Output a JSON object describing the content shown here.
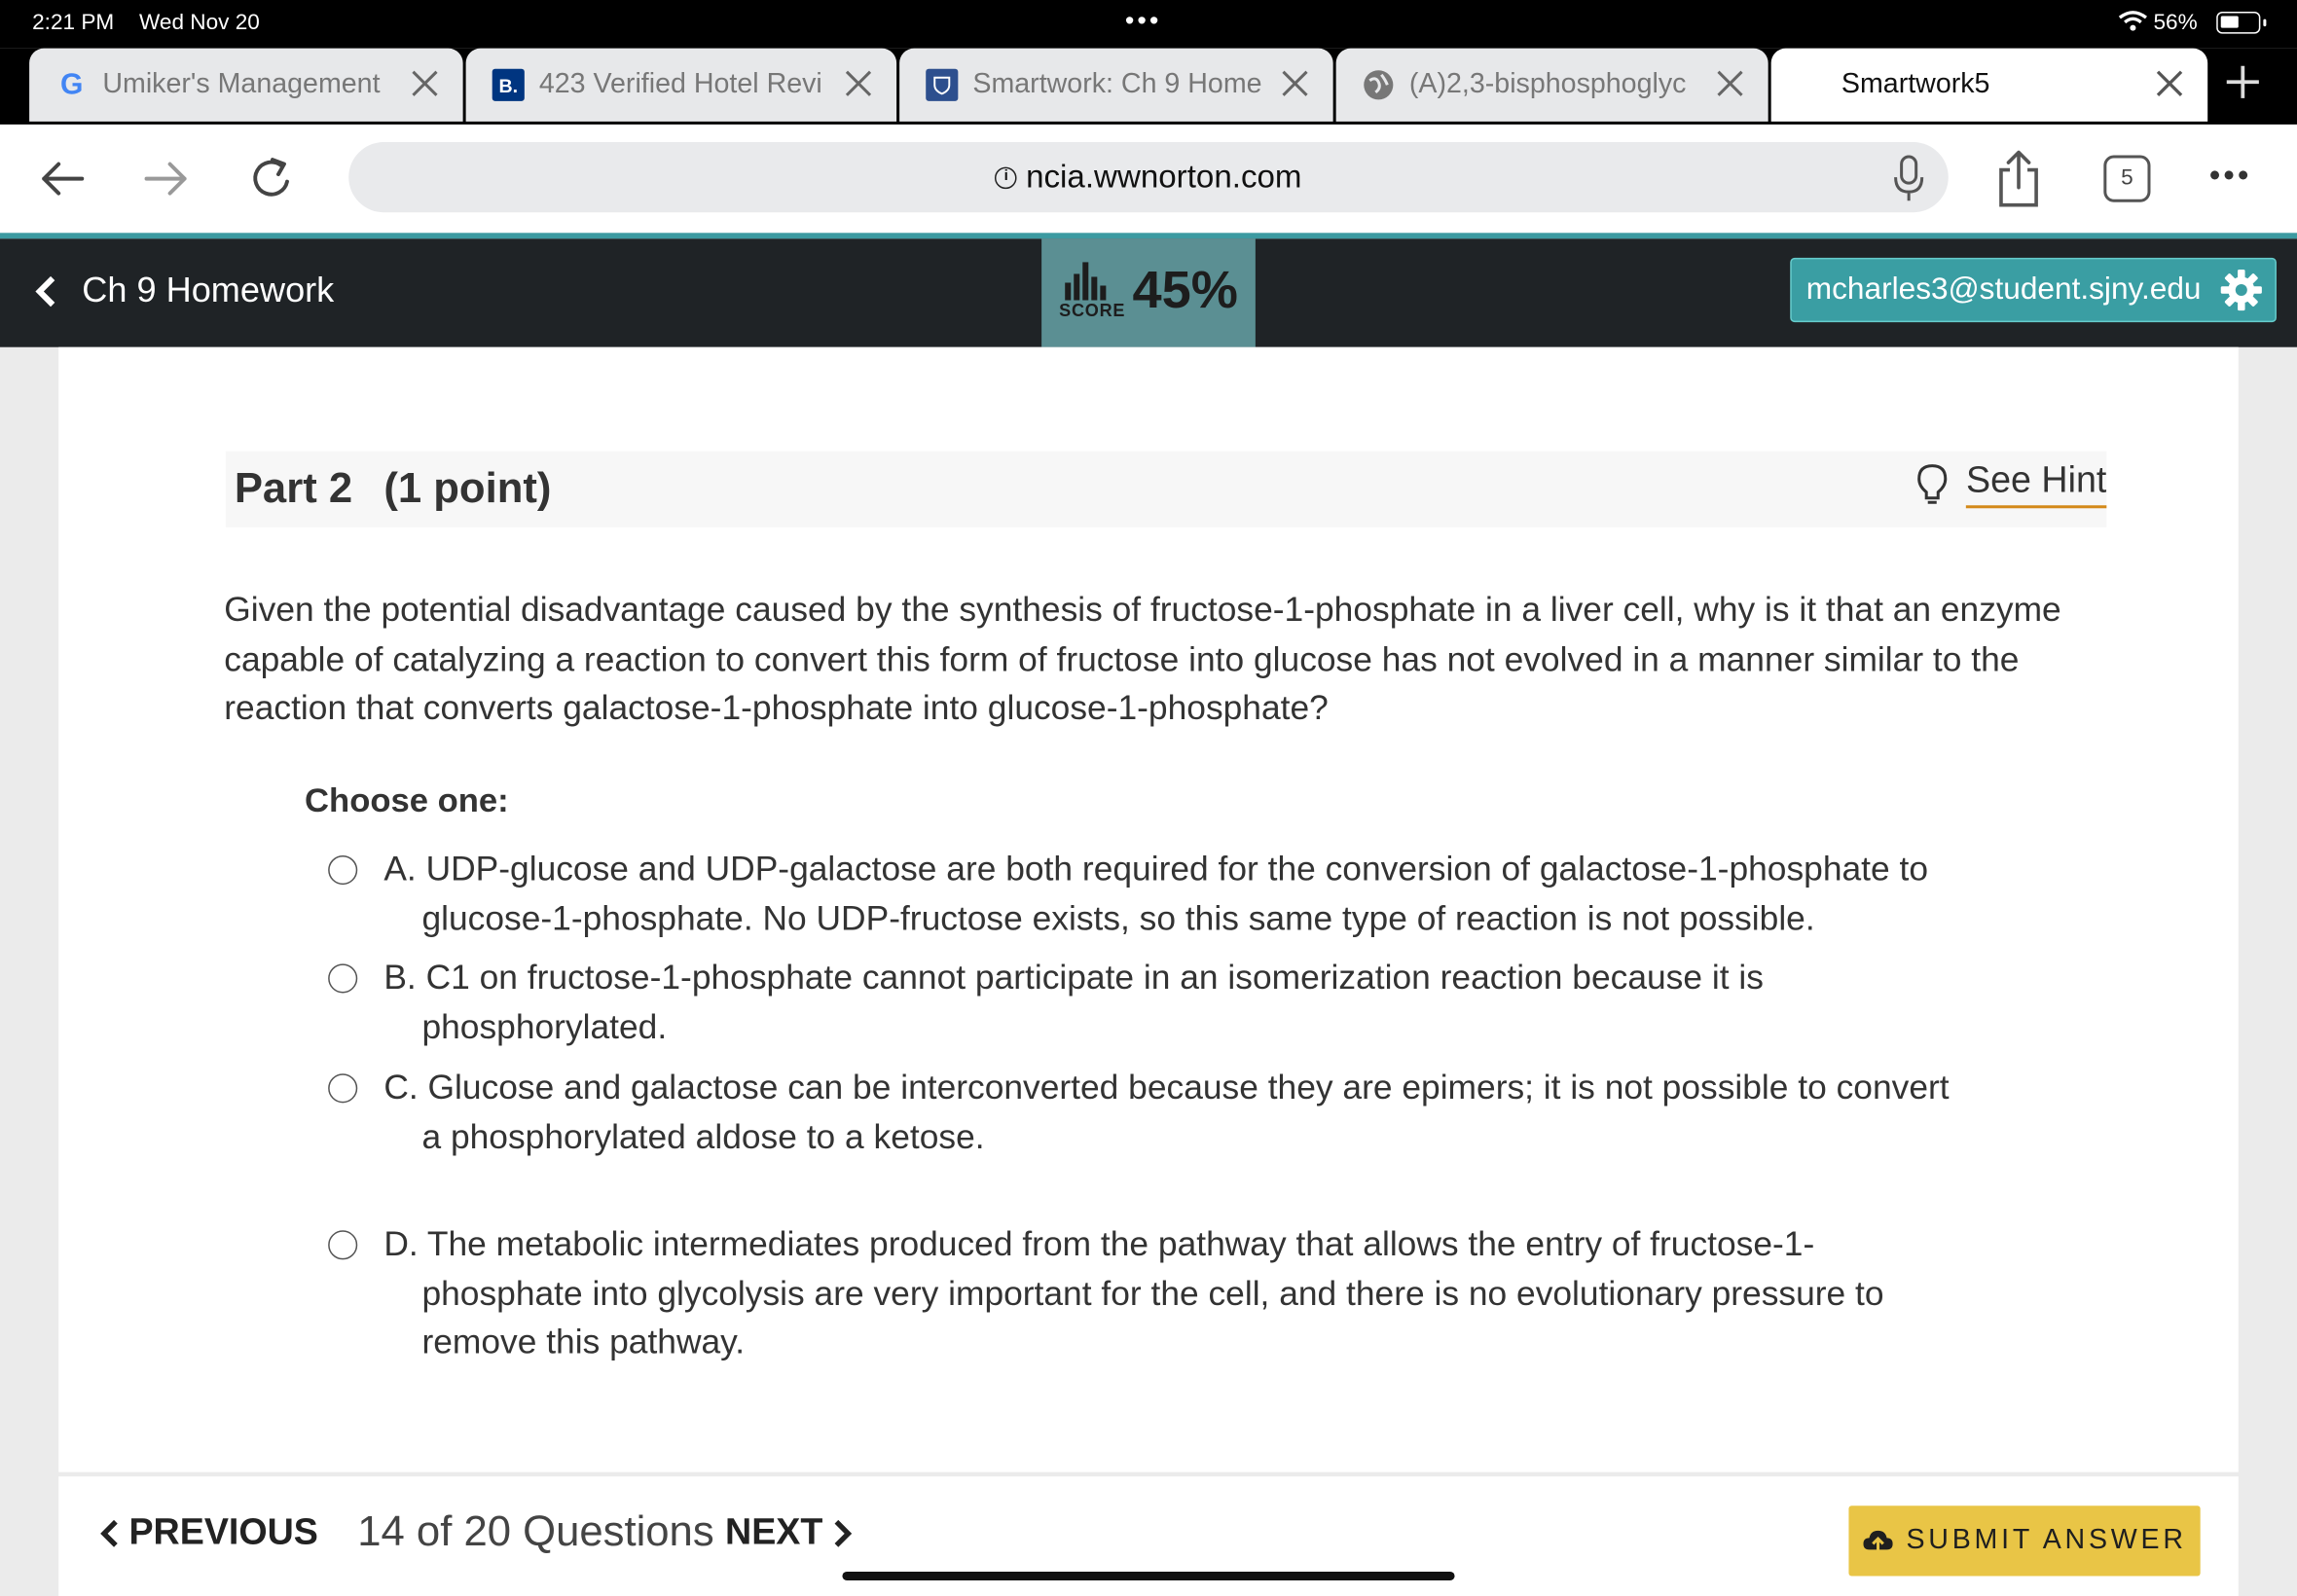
{
  "status_bar": {
    "time": "2:21 PM",
    "date": "Wed Nov 20",
    "battery": "56%"
  },
  "browser": {
    "tabs": [
      {
        "title": "Umiker's Management",
        "favicon": "G"
      },
      {
        "title": "423 Verified Hotel Revi",
        "favicon": "B."
      },
      {
        "title": "Smartwork: Ch 9 Home",
        "favicon": "shield"
      },
      {
        "title": "(A)2,3-bisphosphoglyc",
        "favicon": "globe"
      },
      {
        "title": "Smartwork5",
        "favicon": ""
      }
    ],
    "url": "ncia.wwnorton.com",
    "tab_count": "5"
  },
  "app_header": {
    "back_label": "Ch 9 Homework",
    "score_label": "SCORE",
    "score_value": "45%",
    "user_email": "mcharles3@student.sjny.edu"
  },
  "question": {
    "part": "Part 2",
    "points": "(1 point)",
    "hint_label": "See Hint",
    "prompt": "Given the potential disadvantage caused by the synthesis of fructose-1-phosphate in a liver cell, why is it that an enzyme capable of catalyzing a reaction to convert this form of fructose into glucose has not evolved in a manner similar to the reaction that converts galactose-1-phosphate into glucose-1-phosphate?",
    "choose_label": "Choose one:",
    "options": [
      {
        "text": "A. UDP-glucose and UDP-galactose are both required for the conversion of galactose-1-phosphate to glucose-1-phosphate. No UDP-fructose exists, so this same type of reaction is not possible."
      },
      {
        "text": "B. C1 on fructose-1-phosphate cannot participate in an isomerization reaction because it is phosphorylated."
      },
      {
        "text": "C. Glucose and galactose can be interconverted because they are epimers; it is not possible to convert a phosphorylated aldose to a ketose."
      },
      {
        "text": "D. The metabolic intermediates produced from the pathway that allows the entry of fructose-1-phosphate into glycolysis are very important for the cell, and there is no evolutionary pressure to remove this pathway."
      }
    ]
  },
  "footer": {
    "previous_label": "PREVIOUS",
    "counter": "14 of 20 Questions",
    "next_label": "NEXT",
    "submit_label": "SUBMIT ANSWER"
  },
  "colors": {
    "teal": "#3a9ea3",
    "score_bg": "#5b8f93",
    "header_bg": "#1f2326",
    "submit_bg": "#e9c546",
    "hint_underline": "#d4891a"
  }
}
